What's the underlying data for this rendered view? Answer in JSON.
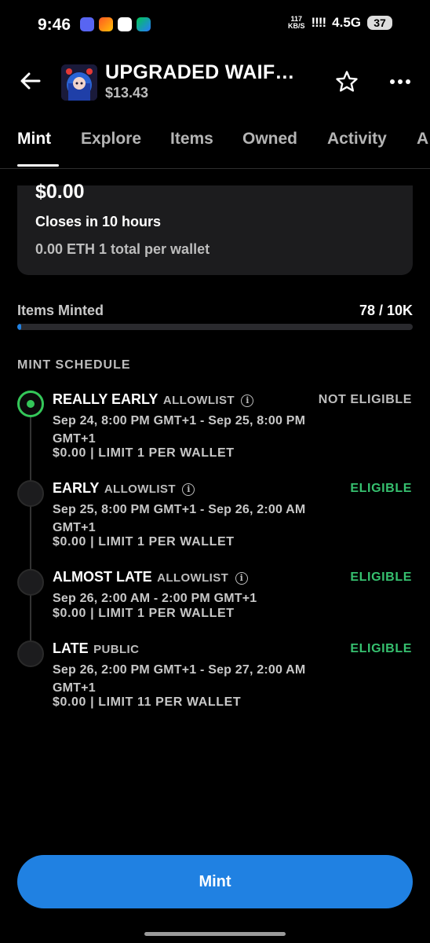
{
  "status_bar": {
    "time": "9:46",
    "net_speed_value": "117",
    "net_speed_unit": "KB/S",
    "signal": "!!!!",
    "network": "4.5G",
    "battery": "37",
    "app_icons": [
      "discord-icon",
      "shopping-icon",
      "play-store-icon",
      "play-games-icon"
    ]
  },
  "header": {
    "title": "UPGRADED WAIF…",
    "price": "$13.43"
  },
  "tabs": [
    {
      "label": "Mint",
      "active": true
    },
    {
      "label": "Explore",
      "active": false
    },
    {
      "label": "Items",
      "active": false
    },
    {
      "label": "Owned",
      "active": false
    },
    {
      "label": "Activity",
      "active": false
    },
    {
      "label": "A",
      "active": false
    }
  ],
  "price_card": {
    "price": "$0.00",
    "closes": "Closes in 10 hours",
    "detail": "0.00 ETH  1 total per wallet"
  },
  "minted": {
    "label": "Items Minted",
    "count": "78 / 10K",
    "progress_fraction": 0.0078
  },
  "schedule": {
    "heading": "MINT SCHEDULE",
    "stages": [
      {
        "name": "REALLY EARLY",
        "type": "ALLOWLIST",
        "status": "NOT ELIGIBLE",
        "dates": "Sep 24, 8:00 PM GMT+1 - Sep 25, 8:00 PM GMT+1",
        "price": "$0.00 | LIMIT 1 PER WALLET"
      },
      {
        "name": "EARLY",
        "type": "ALLOWLIST",
        "status": "ELIGIBLE",
        "dates": "Sep 25, 8:00 PM GMT+1 - Sep 26, 2:00 AM GMT+1",
        "price": "$0.00 | LIMIT 1 PER WALLET"
      },
      {
        "name": "ALMOST LATE",
        "type": "ALLOWLIST",
        "status": "ELIGIBLE",
        "dates": "Sep 26, 2:00 AM - 2:00 PM GMT+1",
        "price": "$0.00 | LIMIT 1 PER WALLET"
      },
      {
        "name": "LATE",
        "type": "PUBLIC",
        "status": "ELIGIBLE",
        "dates": "Sep 26, 2:00 PM GMT+1 - Sep 27, 2:00 AM GMT+1",
        "price": "$0.00 | LIMIT 11 PER WALLET"
      }
    ]
  },
  "mint_button": {
    "label": "Mint"
  },
  "colors": {
    "accent": "#2081e2",
    "eligible": "#36c06f",
    "active_dot": "#34c759",
    "background": "#000000",
    "card": "#1c1c1e"
  }
}
